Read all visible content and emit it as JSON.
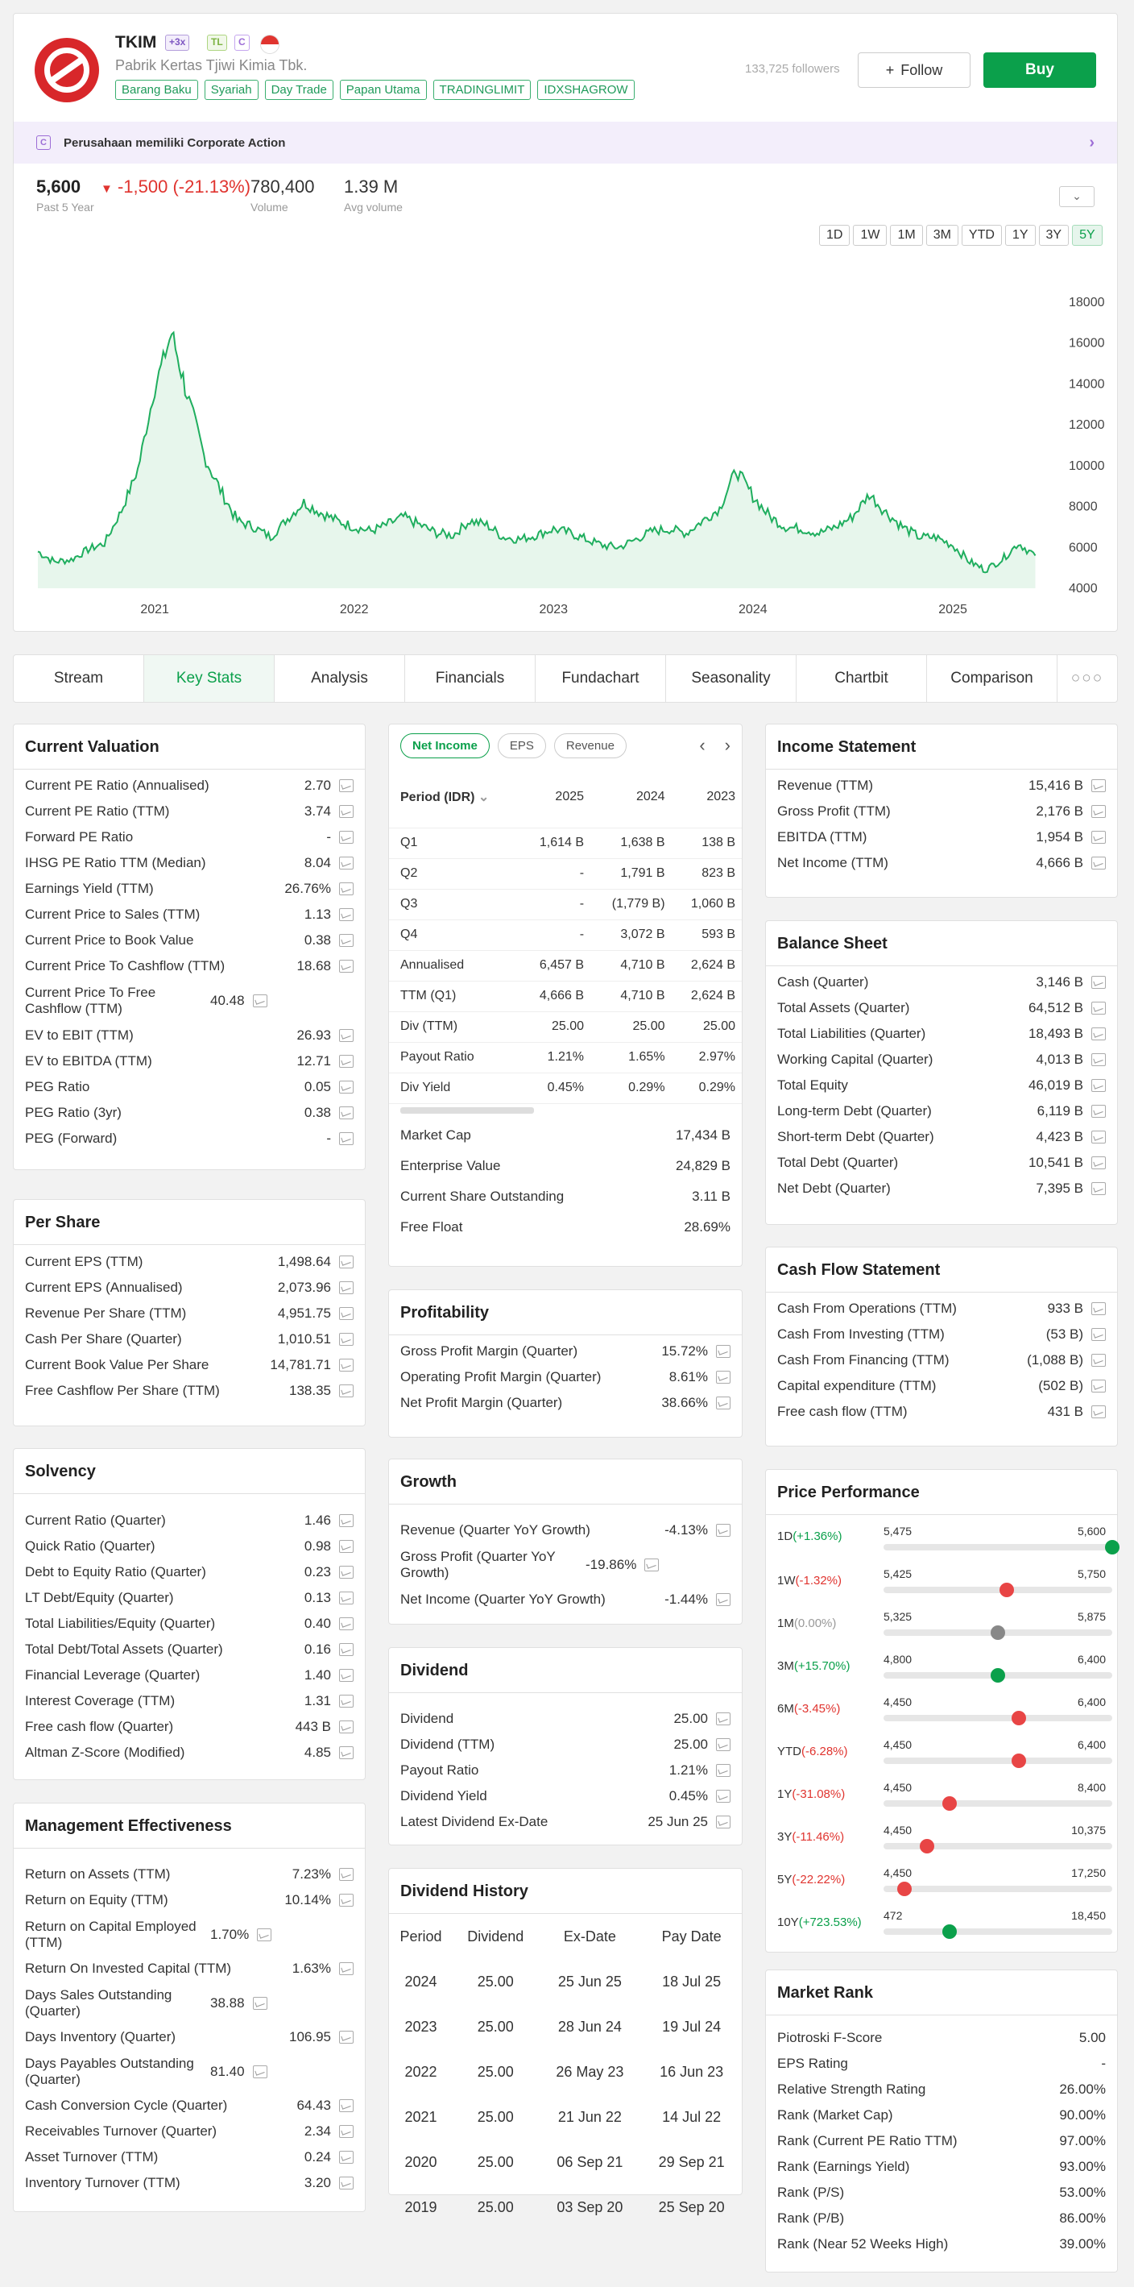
{
  "header": {
    "ticker": "TKIM",
    "badges": [
      "+3x",
      "TL",
      "C"
    ],
    "company": "Pabrik Kertas Tjiwi Kimia Tbk.",
    "tags": [
      "Barang Baku",
      "Syariah",
      "Day Trade",
      "Papan Utama",
      "TRADINGLIMIT",
      "IDXSHAGROW"
    ],
    "followers": "133,725 followers",
    "follow_label": "Follow",
    "buy_label": "Buy",
    "corp_action": "Perusahaan memiliki Corporate Action",
    "corp_icon": "C"
  },
  "quote": {
    "price": "5,600",
    "change": "-1,500 (-21.13%)",
    "period": "Past 5 Year",
    "volume": "780,400",
    "volume_label": "Volume",
    "avg_volume": "1.39 M",
    "avg_volume_label": "Avg volume"
  },
  "ranges": [
    "1D",
    "1W",
    "1M",
    "3M",
    "YTD",
    "1Y",
    "3Y",
    "5Y"
  ],
  "chart_data": {
    "type": "area",
    "title": "",
    "x_ticks": [
      "2021",
      "2022",
      "2023",
      "2024",
      "2025"
    ],
    "y_ticks": [
      "18000",
      "16000",
      "14000",
      "12000",
      "10000",
      "8000",
      "6000",
      "4000"
    ],
    "ylim": [
      4000,
      18000
    ],
    "points": [
      [
        "2020-06",
        5800
      ],
      [
        "2020-07",
        5300
      ],
      [
        "2020-08",
        5400
      ],
      [
        "2020-09",
        5900
      ],
      [
        "2020-10",
        6200
      ],
      [
        "2020-11",
        7800
      ],
      [
        "2020-12",
        9800
      ],
      [
        "2021-01",
        13800
      ],
      [
        "2021-02",
        16500
      ],
      [
        "2021-03",
        13500
      ],
      [
        "2021-04",
        10500
      ],
      [
        "2021-05",
        8800
      ],
      [
        "2021-06",
        7300
      ],
      [
        "2021-07",
        7000
      ],
      [
        "2021-08",
        6500
      ],
      [
        "2021-09",
        7400
      ],
      [
        "2021-10",
        8200
      ],
      [
        "2021-11",
        7700
      ],
      [
        "2021-12",
        7300
      ],
      [
        "2022-01",
        7000
      ],
      [
        "2022-02",
        6800
      ],
      [
        "2022-03",
        7100
      ],
      [
        "2022-04",
        7500
      ],
      [
        "2022-05",
        7100
      ],
      [
        "2022-06",
        6700
      ],
      [
        "2022-07",
        6600
      ],
      [
        "2022-08",
        7300
      ],
      [
        "2022-09",
        7100
      ],
      [
        "2022-10",
        6500
      ],
      [
        "2022-11",
        6400
      ],
      [
        "2022-12",
        6600
      ],
      [
        "2023-01",
        6900
      ],
      [
        "2023-02",
        6700
      ],
      [
        "2023-03",
        6400
      ],
      [
        "2023-04",
        6100
      ],
      [
        "2023-05",
        6000
      ],
      [
        "2023-06",
        6400
      ],
      [
        "2023-07",
        6800
      ],
      [
        "2023-08",
        6900
      ],
      [
        "2023-09",
        6700
      ],
      [
        "2023-10",
        7300
      ],
      [
        "2023-11",
        7900
      ],
      [
        "2023-12",
        9800
      ],
      [
        "2024-01",
        8500
      ],
      [
        "2024-02",
        7500
      ],
      [
        "2024-03",
        7000
      ],
      [
        "2024-04",
        6900
      ],
      [
        "2024-05",
        6700
      ],
      [
        "2024-06",
        7000
      ],
      [
        "2024-07",
        7500
      ],
      [
        "2024-08",
        8600
      ],
      [
        "2024-09",
        7700
      ],
      [
        "2024-10",
        7000
      ],
      [
        "2024-11",
        6500
      ],
      [
        "2024-12",
        6500
      ],
      [
        "2025-01",
        6100
      ],
      [
        "2025-02",
        5300
      ],
      [
        "2025-03",
        4900
      ],
      [
        "2025-04",
        5400
      ],
      [
        "2025-05",
        6200
      ],
      [
        "2025-06",
        5600
      ]
    ]
  },
  "tabs": [
    "Stream",
    "Key Stats",
    "Analysis",
    "Financials",
    "Fundachart",
    "Seasonality",
    "Chartbit",
    "Comparison",
    "○○○"
  ],
  "current_valuation": {
    "title": "Current Valuation",
    "rows": [
      [
        "Current PE Ratio (Annualised)",
        "2.70"
      ],
      [
        "Current PE Ratio (TTM)",
        "3.74"
      ],
      [
        "Forward PE Ratio",
        "-"
      ],
      [
        "IHSG PE Ratio TTM (Median)",
        "8.04"
      ],
      [
        "Earnings Yield (TTM)",
        "26.76%"
      ],
      [
        "Current Price to Sales (TTM)",
        "1.13"
      ],
      [
        "Current Price to Book Value",
        "0.38"
      ],
      [
        "Current Price To Cashflow (TTM)",
        "18.68"
      ],
      [
        "Current Price To Free Cashflow (TTM)",
        "40.48"
      ],
      [
        "EV to EBIT (TTM)",
        "26.93"
      ],
      [
        "EV to EBITDA (TTM)",
        "12.71"
      ],
      [
        "PEG Ratio",
        "0.05"
      ],
      [
        "PEG Ratio (3yr)",
        "0.38"
      ],
      [
        "PEG (Forward)",
        "-"
      ]
    ]
  },
  "per_share": {
    "title": "Per Share",
    "rows": [
      [
        "Current EPS (TTM)",
        "1,498.64"
      ],
      [
        "Current EPS (Annualised)",
        "2,073.96"
      ],
      [
        "Revenue Per Share (TTM)",
        "4,951.75"
      ],
      [
        "Cash Per Share (Quarter)",
        "1,010.51"
      ],
      [
        "Current Book Value Per Share",
        "14,781.71"
      ],
      [
        "Free Cashflow Per Share (TTM)",
        "138.35"
      ]
    ]
  },
  "solvency": {
    "title": "Solvency",
    "rows": [
      [
        "Current Ratio (Quarter)",
        "1.46"
      ],
      [
        "Quick Ratio (Quarter)",
        "0.98"
      ],
      [
        "Debt to Equity Ratio (Quarter)",
        "0.23"
      ],
      [
        "LT Debt/Equity (Quarter)",
        "0.13"
      ],
      [
        "Total Liabilities/Equity (Quarter)",
        "0.40"
      ],
      [
        "Total Debt/Total Assets (Quarter)",
        "0.16"
      ],
      [
        "Financial Leverage (Quarter)",
        "1.40"
      ],
      [
        "Interest Coverage (TTM)",
        "1.31"
      ],
      [
        "Free cash flow (Quarter)",
        "443 B"
      ],
      [
        "Altman Z-Score (Modified)",
        "4.85"
      ]
    ]
  },
  "mgmt": {
    "title": "Management Effectiveness",
    "rows": [
      [
        "Return on Assets (TTM)",
        "7.23%"
      ],
      [
        "Return on Equity (TTM)",
        "10.14%"
      ],
      [
        "Return on Capital Employed (TTM)",
        "1.70%"
      ],
      [
        "Return On Invested Capital (TTM)",
        "1.63%"
      ],
      [
        "Days Sales Outstanding (Quarter)",
        "38.88"
      ],
      [
        "Days Inventory (Quarter)",
        "106.95"
      ],
      [
        "Days Payables Outstanding (Quarter)",
        "81.40"
      ],
      [
        "Cash Conversion Cycle (Quarter)",
        "64.43"
      ],
      [
        "Receivables Turnover (Quarter)",
        "2.34"
      ],
      [
        "Asset Turnover (TTM)",
        "0.24"
      ],
      [
        "Inventory Turnover (TTM)",
        "3.20"
      ]
    ]
  },
  "net_income": {
    "pills": [
      "Net Income",
      "EPS",
      "Revenue"
    ],
    "header": [
      "Period (IDR)",
      "2025",
      "2024",
      "2023"
    ],
    "rows": [
      [
        "Q1",
        "1,614 B",
        "1,638 B",
        "138 B"
      ],
      [
        "Q2",
        "-",
        "1,791 B",
        "823 B"
      ],
      [
        "Q3",
        "-",
        "(1,779 B)",
        "1,060 B"
      ],
      [
        "Q4",
        "-",
        "3,072 B",
        "593 B"
      ],
      [
        "Annualised",
        "6,457 B",
        "4,710 B",
        "2,624 B"
      ],
      [
        "TTM (Q1)",
        "4,666 B",
        "4,710 B",
        "2,624 B"
      ],
      [
        "Div (TTM)",
        "25.00",
        "25.00",
        "25.00"
      ],
      [
        "Payout Ratio",
        "1.21%",
        "1.65%",
        "2.97%"
      ],
      [
        "Div Yield",
        "0.45%",
        "0.29%",
        "0.29%"
      ]
    ],
    "extra": [
      [
        "Market Cap",
        "17,434 B"
      ],
      [
        "Enterprise Value",
        "24,829 B"
      ],
      [
        "Current Share Outstanding",
        "3.11 B"
      ],
      [
        "Free Float",
        "28.69%"
      ]
    ]
  },
  "profitability": {
    "title": "Profitability",
    "rows": [
      [
        "Gross Profit Margin (Quarter)",
        "15.72%"
      ],
      [
        "Operating Profit Margin (Quarter)",
        "8.61%"
      ],
      [
        "Net Profit Margin (Quarter)",
        "38.66%"
      ]
    ]
  },
  "growth": {
    "title": "Growth",
    "rows": [
      [
        "Revenue (Quarter YoY Growth)",
        "-4.13%"
      ],
      [
        "Gross Profit (Quarter YoY Growth)",
        "-19.86%"
      ],
      [
        "Net Income (Quarter YoY Growth)",
        "-1.44%"
      ]
    ]
  },
  "dividend": {
    "title": "Dividend",
    "rows": [
      [
        "Dividend",
        "25.00"
      ],
      [
        "Dividend (TTM)",
        "25.00"
      ],
      [
        "Payout Ratio",
        "1.21%"
      ],
      [
        "Dividend Yield",
        "0.45%"
      ],
      [
        "Latest Dividend Ex-Date",
        "25 Jun 25"
      ]
    ]
  },
  "div_history": {
    "title": "Dividend History",
    "header": [
      "Period",
      "Dividend",
      "Ex-Date",
      "Pay Date"
    ],
    "rows": [
      [
        "2024",
        "25.00",
        "25 Jun 25",
        "18 Jul 25"
      ],
      [
        "2023",
        "25.00",
        "28 Jun 24",
        "19 Jul 24"
      ],
      [
        "2022",
        "25.00",
        "26 May 23",
        "16 Jun 23"
      ],
      [
        "2021",
        "25.00",
        "21 Jun 22",
        "14 Jul 22"
      ],
      [
        "2020",
        "25.00",
        "06 Sep 21",
        "29 Sep 21"
      ],
      [
        "2019",
        "25.00",
        "03 Sep 20",
        "25 Sep 20"
      ]
    ]
  },
  "income": {
    "title": "Income Statement",
    "rows": [
      [
        "Revenue (TTM)",
        "15,416 B"
      ],
      [
        "Gross Profit (TTM)",
        "2,176 B"
      ],
      [
        "EBITDA (TTM)",
        "1,954 B"
      ],
      [
        "Net Income (TTM)",
        "4,666 B"
      ]
    ]
  },
  "balance": {
    "title": "Balance Sheet",
    "rows": [
      [
        "Cash (Quarter)",
        "3,146 B"
      ],
      [
        "Total Assets (Quarter)",
        "64,512 B"
      ],
      [
        "Total Liabilities (Quarter)",
        "18,493 B"
      ],
      [
        "Working Capital (Quarter)",
        "4,013 B"
      ],
      [
        "Total Equity",
        "46,019 B"
      ],
      [
        "Long-term Debt (Quarter)",
        "6,119 B"
      ],
      [
        "Short-term Debt (Quarter)",
        "4,423 B"
      ],
      [
        "Total Debt (Quarter)",
        "10,541 B"
      ],
      [
        "Net Debt (Quarter)",
        "7,395 B"
      ]
    ]
  },
  "cashflow": {
    "title": "Cash Flow Statement",
    "rows": [
      [
        "Cash From Operations (TTM)",
        "933 B"
      ],
      [
        "Cash From Investing (TTM)",
        "(53 B)"
      ],
      [
        "Cash From Financing (TTM)",
        "(1,088 B)"
      ],
      [
        "Capital expenditure (TTM)",
        "(502 B)"
      ],
      [
        "Free cash flow (TTM)",
        "431 B"
      ]
    ]
  },
  "price_perf": {
    "title": "Price Performance",
    "rows": [
      {
        "p": "1D",
        "c": "(+1.36%)",
        "s": "p",
        "lo": "5,475",
        "hi": "5,600",
        "pos": 1.0,
        "dot": "#0ba04b"
      },
      {
        "p": "1W",
        "c": "(-1.32%)",
        "s": "n",
        "lo": "5,425",
        "hi": "5,750",
        "pos": 0.54,
        "dot": "#e84545"
      },
      {
        "p": "1M",
        "c": "(0.00%)",
        "s": "z",
        "lo": "5,325",
        "hi": "5,875",
        "pos": 0.5,
        "dot": "#888888"
      },
      {
        "p": "3M",
        "c": "(+15.70%)",
        "s": "p",
        "lo": "4,800",
        "hi": "6,400",
        "pos": 0.5,
        "dot": "#0ba04b"
      },
      {
        "p": "6M",
        "c": "(-3.45%)",
        "s": "n",
        "lo": "4,450",
        "hi": "6,400",
        "pos": 0.59,
        "dot": "#e84545"
      },
      {
        "p": "YTD",
        "c": "(-6.28%)",
        "s": "n",
        "lo": "4,450",
        "hi": "6,400",
        "pos": 0.59,
        "dot": "#e84545"
      },
      {
        "p": "1Y",
        "c": "(-31.08%)",
        "s": "n",
        "lo": "4,450",
        "hi": "8,400",
        "pos": 0.29,
        "dot": "#e84545"
      },
      {
        "p": "3Y",
        "c": "(-11.46%)",
        "s": "n",
        "lo": "4,450",
        "hi": "10,375",
        "pos": 0.19,
        "dot": "#e84545"
      },
      {
        "p": "5Y",
        "c": "(-22.22%)",
        "s": "n",
        "lo": "4,450",
        "hi": "17,250",
        "pos": 0.09,
        "dot": "#e84545"
      },
      {
        "p": "10Y",
        "c": "(+723.53%)",
        "s": "p",
        "lo": "472",
        "hi": "18,450",
        "pos": 0.29,
        "dot": "#0ba04b"
      }
    ]
  },
  "market_rank": {
    "title": "Market Rank",
    "rows": [
      [
        "Piotroski F-Score",
        "5.00"
      ],
      [
        "EPS Rating",
        "-"
      ],
      [
        "Relative Strength Rating",
        "26.00%"
      ],
      [
        "Rank (Market Cap)",
        "90.00%"
      ],
      [
        "Rank (Current PE Ratio TTM)",
        "97.00%"
      ],
      [
        "Rank (Earnings Yield)",
        "93.00%"
      ],
      [
        "Rank (P/S)",
        "53.00%"
      ],
      [
        "Rank (P/B)",
        "86.00%"
      ],
      [
        "Rank (Near 52 Weeks High)",
        "39.00%"
      ]
    ]
  },
  "colors": {
    "accent": "#0ba04b",
    "negative": "#e0342f",
    "chart_line": "#1fae5e",
    "chart_fill": "#e7f6ec"
  }
}
